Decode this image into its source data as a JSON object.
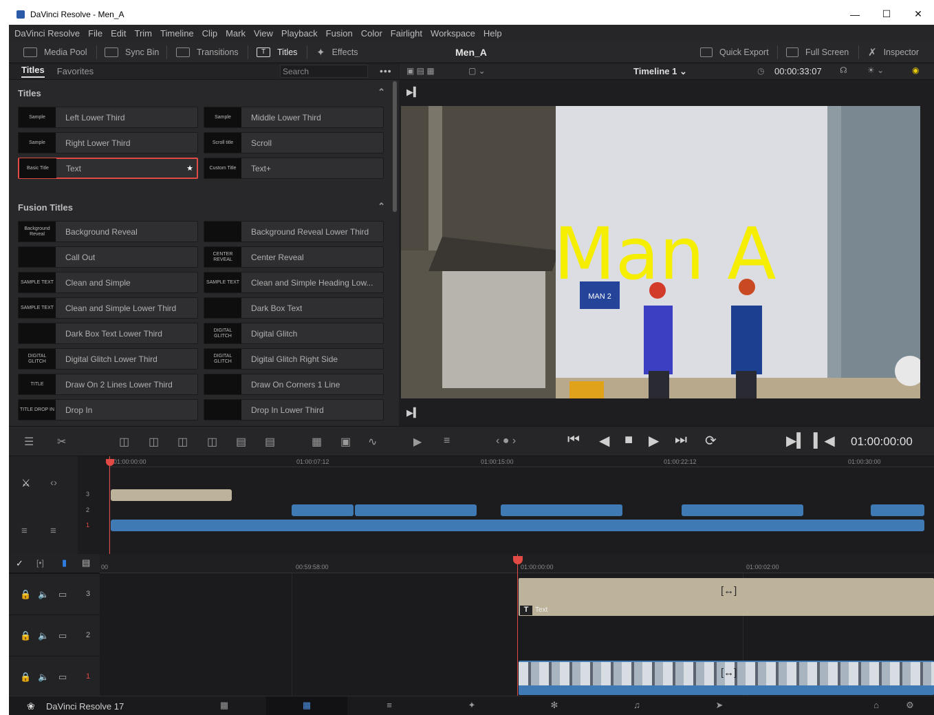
{
  "window": {
    "title": "DaVinci Resolve - Men_A"
  },
  "menu": [
    "DaVinci Resolve",
    "File",
    "Edit",
    "Trim",
    "Timeline",
    "Clip",
    "Mark",
    "View",
    "Playback",
    "Fusion",
    "Color",
    "Fairlight",
    "Workspace",
    "Help"
  ],
  "toolbar": {
    "media_pool": "Media Pool",
    "sync_bin": "Sync Bin",
    "transitions": "Transitions",
    "titles": "Titles",
    "effects": "Effects",
    "project_name": "Men_A",
    "quick_export": "Quick Export",
    "full_screen": "Full Screen",
    "inspector": "Inspector"
  },
  "left_panel": {
    "tabs": [
      "Titles",
      "Favorites"
    ],
    "search_placeholder": "Search",
    "titles_section": "Titles",
    "titles": [
      {
        "label": "Left Lower Third",
        "thumb": "Sample"
      },
      {
        "label": "Middle Lower Third",
        "thumb": "Sample"
      },
      {
        "label": "Right Lower Third",
        "thumb": "Sample"
      },
      {
        "label": "Scroll",
        "thumb": "Scroll title"
      },
      {
        "label": "Text",
        "thumb": "Basic Title",
        "selected": true
      },
      {
        "label": "Text+",
        "thumb": "Custom Title"
      }
    ],
    "fusion_section": "Fusion Titles",
    "fusion_titles": [
      {
        "label": "Background Reveal",
        "thumb": "Background Reveal"
      },
      {
        "label": "Background Reveal Lower Third",
        "thumb": ""
      },
      {
        "label": "Call Out",
        "thumb": ""
      },
      {
        "label": "Center Reveal",
        "thumb": "CENTER REVEAL"
      },
      {
        "label": "Clean and Simple",
        "thumb": "SAMPLE TEXT"
      },
      {
        "label": "Clean and Simple Heading Low...",
        "thumb": "SAMPLE TEXT"
      },
      {
        "label": "Clean and Simple Lower Third",
        "thumb": "SAMPLE TEXT"
      },
      {
        "label": "Dark Box Text",
        "thumb": ""
      },
      {
        "label": "Dark Box Text Lower Third",
        "thumb": ""
      },
      {
        "label": "Digital Glitch",
        "thumb": "DIGITAL GLITCH"
      },
      {
        "label": "Digital Glitch Lower Third",
        "thumb": "DIGITAL GLITCH"
      },
      {
        "label": "Digital Glitch Right Side",
        "thumb": "DIGITAL GLITCH"
      },
      {
        "label": "Draw On 2 Lines Lower Third",
        "thumb": "TITLE"
      },
      {
        "label": "Draw On Corners 1 Line",
        "thumb": ""
      },
      {
        "label": "Drop In",
        "thumb": "TITLE DROP IN"
      },
      {
        "label": "Drop In Lower Third",
        "thumb": ""
      }
    ]
  },
  "viewer": {
    "timeline_name": "Timeline 1",
    "timecode": "00:00:33:07",
    "overlay_text": "Man A",
    "sign_text": "MAN 2"
  },
  "transport": {
    "timecode": "01:00:00:00"
  },
  "upper_timeline": {
    "ruler": [
      "01:00:00:00",
      "01:00:07:12",
      "01:00:15:00",
      "01:00:22:12",
      "01:00:30:00"
    ],
    "tracks": [
      "3",
      "2",
      "1"
    ]
  },
  "lower_timeline": {
    "ruler": [
      "00",
      "00:59:58:00",
      "01:00:00:00",
      "01:00:02:00"
    ],
    "tracks": [
      "3",
      "2",
      "1"
    ],
    "text_clip_label": "Text"
  },
  "bottom": {
    "brand": "DaVinci Resolve 17"
  },
  "colors": {
    "accent_red": "#e24a45",
    "clip_blue": "#3f7ab5",
    "clip_tan": "#bdb29a",
    "overlay_yellow": "#f5ee00"
  }
}
